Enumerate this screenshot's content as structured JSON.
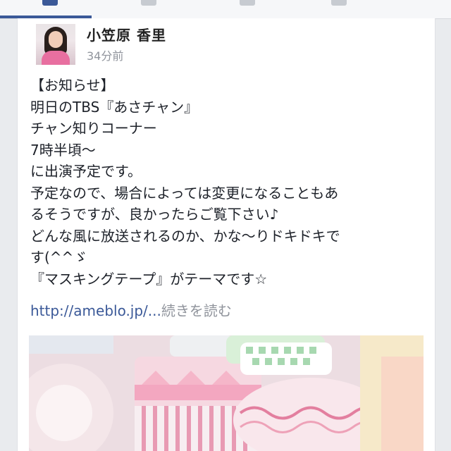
{
  "post": {
    "author": "小笠原 香里",
    "time": "34分前",
    "lines": [
      "【お知らせ】",
      "明日のTBS『あさチャン』",
      "チャン知りコーナー",
      "7時半頃〜",
      "に出演予定です。",
      "予定なので、場合によっては変更になることもあ",
      "るそうですが、良かったらご覧下さい♪",
      "どんな風に放送されるのか、かな〜りドキドキで",
      "す(^^ゞ",
      "『マスキングテープ』がテーマです☆"
    ],
    "link_text": "http://ameblo.jp/...",
    "read_more": "続きを読む"
  },
  "colors": {
    "brand": "#3b5998",
    "text": "#1d2129",
    "muted": "#90949c"
  },
  "icons": {
    "nav": [
      "news-feed-icon",
      "friends-icon",
      "messages-icon",
      "notifications-icon"
    ]
  }
}
